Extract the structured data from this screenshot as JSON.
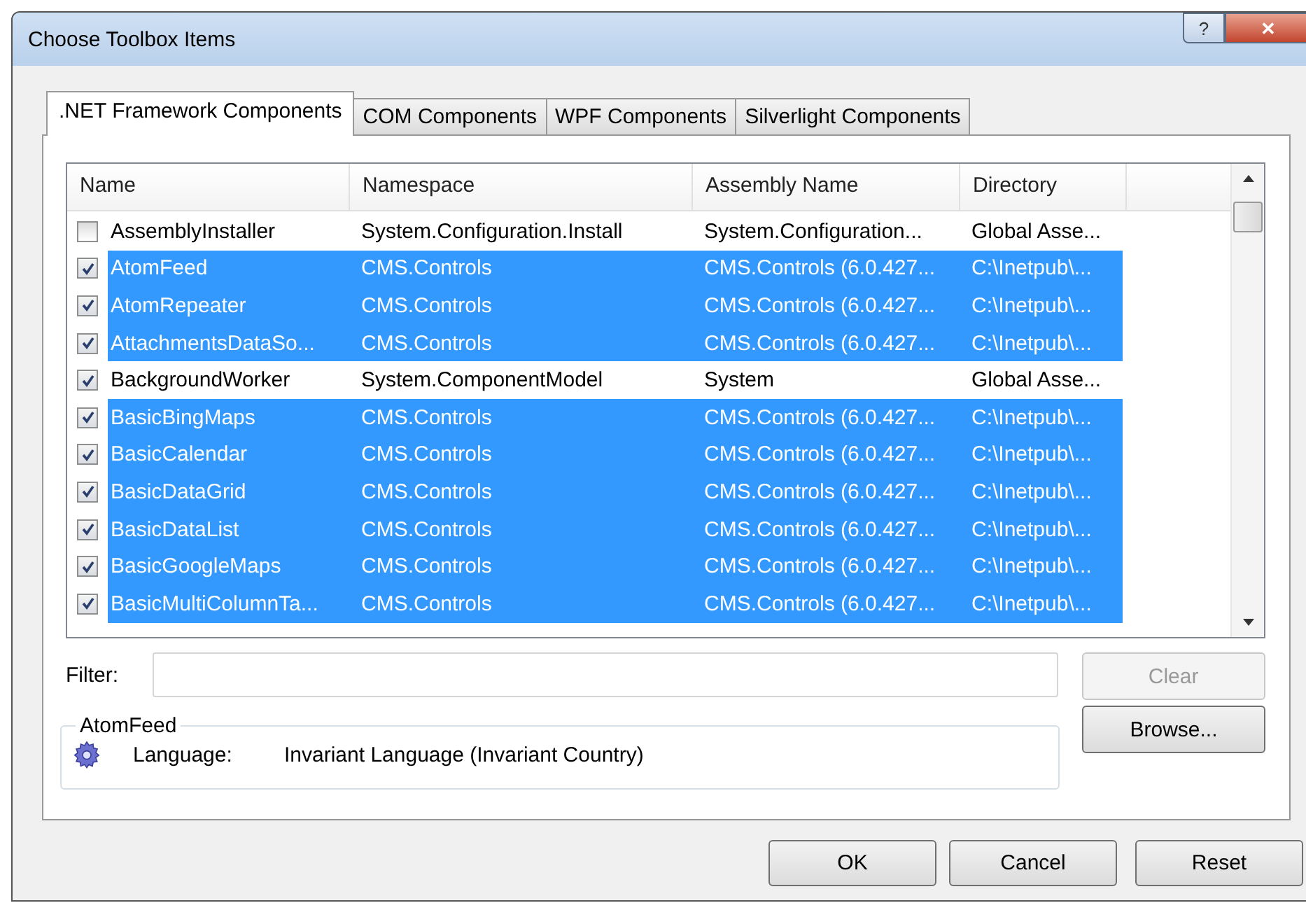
{
  "window": {
    "title": "Choose Toolbox Items",
    "controls": [
      "?",
      "✕"
    ]
  },
  "tabs": [
    {
      "label": ".NET Framework Components",
      "selected": true
    },
    {
      "label": "COM Components",
      "selected": false
    },
    {
      "label": "WPF Components",
      "selected": false
    },
    {
      "label": "Silverlight Components",
      "selected": false
    }
  ],
  "table": {
    "columns": [
      "Name",
      "Namespace",
      "Assembly Name",
      "Directory"
    ],
    "rows": [
      {
        "checked": false,
        "selected": false,
        "cells": [
          "AssemblyInstaller",
          "System.Configuration.Install",
          "System.Configuration...",
          "Global Asse..."
        ]
      },
      {
        "checked": true,
        "selected": true,
        "cells": [
          "AtomFeed",
          "CMS.Controls",
          "CMS.Controls (6.0.427...",
          "C:\\Inetpub\\..."
        ]
      },
      {
        "checked": true,
        "selected": true,
        "cells": [
          "AtomRepeater",
          "CMS.Controls",
          "CMS.Controls (6.0.427...",
          "C:\\Inetpub\\..."
        ]
      },
      {
        "checked": true,
        "selected": true,
        "cells": [
          "AttachmentsDataSo...",
          "CMS.Controls",
          "CMS.Controls (6.0.427...",
          "C:\\Inetpub\\..."
        ]
      },
      {
        "checked": true,
        "selected": false,
        "cells": [
          "BackgroundWorker",
          "System.ComponentModel",
          "System",
          "Global Asse..."
        ]
      },
      {
        "checked": true,
        "selected": true,
        "cells": [
          "BasicBingMaps",
          "CMS.Controls",
          "CMS.Controls (6.0.427...",
          "C:\\Inetpub\\..."
        ]
      },
      {
        "checked": true,
        "selected": true,
        "cells": [
          "BasicCalendar",
          "CMS.Controls",
          "CMS.Controls (6.0.427...",
          "C:\\Inetpub\\..."
        ]
      },
      {
        "checked": true,
        "selected": true,
        "cells": [
          "BasicDataGrid",
          "CMS.Controls",
          "CMS.Controls (6.0.427...",
          "C:\\Inetpub\\..."
        ]
      },
      {
        "checked": true,
        "selected": true,
        "cells": [
          "BasicDataList",
          "CMS.Controls",
          "CMS.Controls (6.0.427...",
          "C:\\Inetpub\\..."
        ]
      },
      {
        "checked": true,
        "selected": true,
        "cells": [
          "BasicGoogleMaps",
          "CMS.Controls",
          "CMS.Controls (6.0.427...",
          "C:\\Inetpub\\..."
        ]
      },
      {
        "checked": true,
        "selected": true,
        "cells": [
          "BasicMultiColumnTa...",
          "CMS.Controls",
          "CMS.Controls (6.0.427...",
          "C:\\Inetpub\\..."
        ]
      }
    ]
  },
  "filter": {
    "label": "Filter:"
  },
  "clear_button": {
    "label": "Clear",
    "disabled": true
  },
  "details": {
    "title": "AtomFeed",
    "label": "Language:",
    "value": "Invariant Language (Invariant Country)"
  },
  "browse_button": {
    "label": "Browse..."
  },
  "buttons": [
    "OK",
    "Cancel",
    "Reset"
  ]
}
